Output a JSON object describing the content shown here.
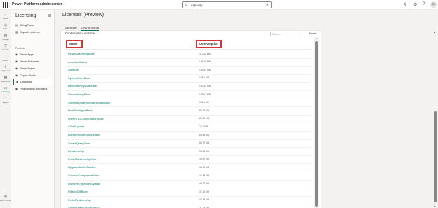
{
  "header": {
    "app_title": "Power Platform admin center",
    "search_value": "capacity",
    "search_icon": "search-icon",
    "avatar_initials": "JN"
  },
  "rail": {
    "items": [
      {
        "label": "Home",
        "icon": "home-icon",
        "glyph": "⌂"
      },
      {
        "label": "Actions",
        "icon": "actions-icon",
        "glyph": "◎"
      },
      {
        "label": "Manage",
        "icon": "manage-icon",
        "glyph": "▤"
      },
      {
        "label": "Security",
        "icon": "shield-icon",
        "glyph": "⛉"
      },
      {
        "label": "Monitor",
        "icon": "monitor-icon",
        "glyph": "◔"
      },
      {
        "label": "Deployment",
        "icon": "deployment-icon",
        "glyph": "⇪"
      },
      {
        "label": "Resources",
        "icon": "resources-icon",
        "glyph": "▦"
      },
      {
        "label": "Licensing",
        "icon": "licensing-icon",
        "glyph": "▭"
      },
      {
        "label": "Support",
        "icon": "support-icon",
        "glyph": "?"
      }
    ],
    "bottom_label": "Admin centers"
  },
  "nav": {
    "title": "Licensing",
    "items_top": [
      {
        "label": "Billing Plans",
        "icon": "billing-icon"
      },
      {
        "label": "Capacity add-ons",
        "icon": "capacity-icon"
      }
    ],
    "section_label": "Products",
    "items": [
      {
        "label": "Power Apps",
        "icon": "power-apps-icon"
      },
      {
        "label": "Power Automate",
        "icon": "power-automate-icon"
      },
      {
        "label": "Power Pages",
        "icon": "power-pages-icon"
      },
      {
        "label": "Copilot Studio",
        "icon": "copilot-icon"
      },
      {
        "label": "Dataverse",
        "icon": "dataverse-icon"
      },
      {
        "label": "Finance and Operations",
        "icon": "finance-icon"
      }
    ],
    "active_item": "Dataverse"
  },
  "page": {
    "title": "Licenses (Preview)",
    "tabs": [
      {
        "label": "Summary"
      },
      {
        "label": "Environments"
      }
    ],
    "active_tab": "Environments"
  },
  "table": {
    "caption": "Consumption per table",
    "search_placeholder": "Search",
    "reset_label": "Reset",
    "col_name": "Name ↓",
    "col_consumption": "Consumption ↓",
    "rows": [
      {
        "name": "PluginAssemblyBase",
        "value": "372.11 MB"
      },
      {
        "name": "LocalizedLabel",
        "value": "186.09 MB"
      },
      {
        "name": "Attribute",
        "value": "183.94 MB"
      },
      {
        "name": "SystemFormBase",
        "value": "168.1 MB"
      },
      {
        "name": "DependencyNodeBase",
        "value": "150.62 MB"
      },
      {
        "name": "DependencyBase",
        "value": "139.42 MB"
      },
      {
        "name": "SdkMessageProcessingStepBase",
        "value": "118.6 MB"
      },
      {
        "name": "RolePrivilegesBase",
        "value": "86.28 MB"
      },
      {
        "name": "msdyn_AIConfigurationBase",
        "value": "80.67 MB"
      },
      {
        "name": "ClientUpdate",
        "value": "72.7 MB"
      },
      {
        "name": "DoNotIncludeSubrDetails",
        "value": "69.84 MB"
      },
      {
        "name": "SavedQueryBase",
        "value": "58.77 MB"
      },
      {
        "name": "Relationship",
        "value": "50.28 MB"
      },
      {
        "name": "EntityRelationshipRole",
        "value": "49.67 MB"
      },
      {
        "name": "UpgradeActionTracker",
        "value": "48.19 MB"
      },
      {
        "name": "SolutionComponentBase",
        "value": "44.89 MB"
      },
      {
        "name": "RuntimeDependencyBase",
        "value": "42.77 MB"
      },
      {
        "name": "RibbonDiffBase",
        "value": "37.42 MB"
      },
      {
        "name": "EntityRelationship",
        "value": "33.45 MB"
      },
      {
        "name": "SavedQueryVisualization",
        "value": "31.28 MB"
      }
    ]
  }
}
